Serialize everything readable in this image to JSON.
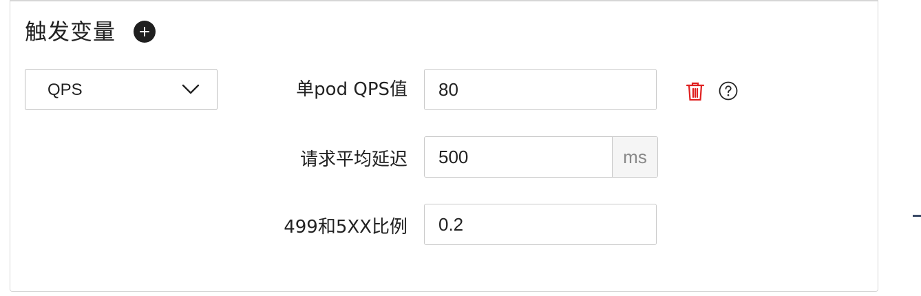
{
  "section": {
    "title": "触发变量",
    "add_icon": "plus-circle-icon"
  },
  "variable_select": {
    "value": "QPS",
    "icon": "chevron-down-icon"
  },
  "fields": [
    {
      "label": "单pod QPS值",
      "value": "80"
    },
    {
      "label": "请求平均延迟",
      "value": "500",
      "unit": "ms"
    },
    {
      "label": "499和5XX比例",
      "value": "0.2"
    }
  ],
  "actions": {
    "delete_icon": "trash-icon",
    "help_icon": "question-circle-icon",
    "delete_color": "#e02020"
  }
}
